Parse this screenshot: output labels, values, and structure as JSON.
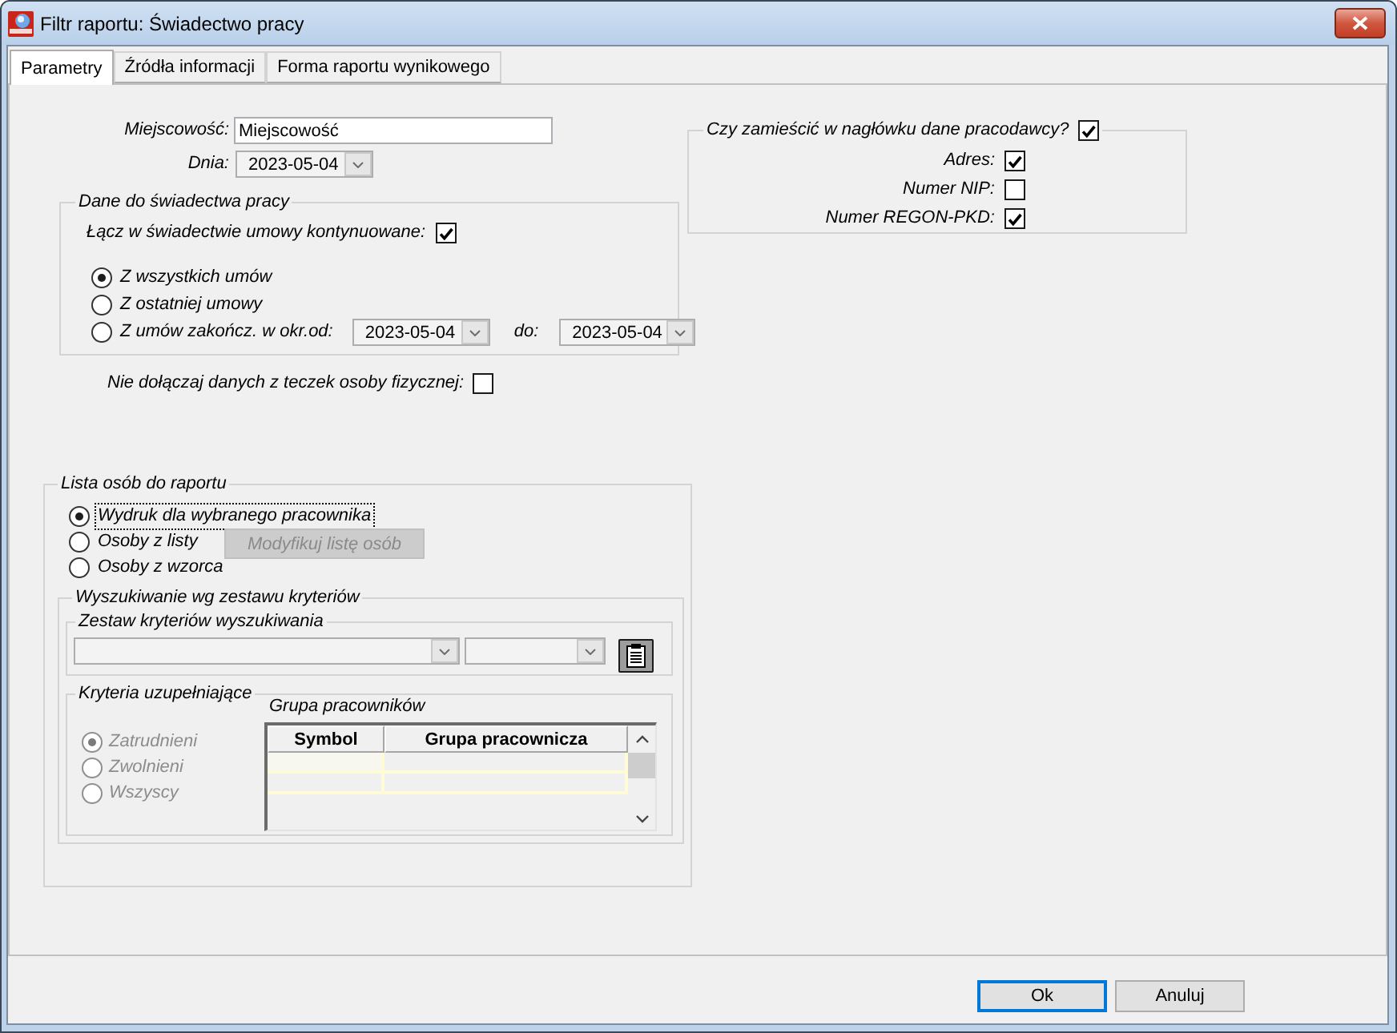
{
  "window": {
    "title": "Filtr raportu: Świadectwo pracy"
  },
  "tabs": [
    {
      "label": "Parametry",
      "selected": true
    },
    {
      "label": "Źródła informacji",
      "selected": false
    },
    {
      "label": "Forma raportu wynikowego",
      "selected": false
    }
  ],
  "place": {
    "label": "Miejscowość:",
    "value": "Miejscowość"
  },
  "date": {
    "label": "Dnia:",
    "value": "2023-05-04"
  },
  "employer_header": {
    "label": "Czy zamieścić w nagłówku dane pracodawcy?",
    "checked": true,
    "items": [
      {
        "label": "Adres:",
        "checked": true
      },
      {
        "label": "Numer NIP:",
        "checked": false
      },
      {
        "label": "Numer REGON-PKD:",
        "checked": true
      }
    ]
  },
  "certificate_data": {
    "title": "Dane do świadectwa pracy",
    "merge_contracts": {
      "label": "Łącz w świadectwie umowy kontynuowane:",
      "checked": true
    },
    "contract_scope": [
      {
        "kind": "plain",
        "label": "Z wszystkich umów",
        "selected": true
      },
      {
        "kind": "plain",
        "label": "Z ostatniej umowy",
        "selected": false
      },
      {
        "kind": "range",
        "label": "Z umów zakończ. w okr.od:",
        "selected": false,
        "date_from": "2023-05-04",
        "to_label": "do:",
        "date_to": "2023-05-04"
      }
    ]
  },
  "exclude_personal_files": {
    "label": "Nie dołączaj danych z teczek osoby fizycznej:",
    "checked": false
  },
  "person_list": {
    "title": "Lista osób do raportu",
    "options": [
      {
        "label": "Wydruk dla wybranego pracownika",
        "selected": true,
        "focused": true
      },
      {
        "label": "Osoby z listy",
        "selected": false,
        "focused": false
      },
      {
        "label": "Osoby z wzorca",
        "selected": false,
        "focused": false
      }
    ],
    "modify_button": {
      "label": "Modyfikuj listę osób",
      "disabled": true
    },
    "criteria_search": {
      "title": "Wyszukiwanie wg zestawu kryteriów",
      "criteria_set": {
        "title": "Zestaw kryteriów wyszukiwania"
      },
      "supplementary": {
        "title": "Kryteria uzupełniające",
        "options": [
          {
            "label": "Zatrudnieni",
            "selected": true,
            "disabled": true
          },
          {
            "label": "Zwolnieni",
            "selected": false,
            "disabled": true
          },
          {
            "label": "Wszyscy",
            "selected": false,
            "disabled": true
          }
        ],
        "employee_groups": {
          "title": "Grupa pracowników",
          "columns": [
            "Symbol",
            "Grupa pracownicza"
          ]
        }
      }
    }
  },
  "buttons": [
    {
      "label": "Ok",
      "default": true
    },
    {
      "label": "Anuluj",
      "default": false
    }
  ]
}
